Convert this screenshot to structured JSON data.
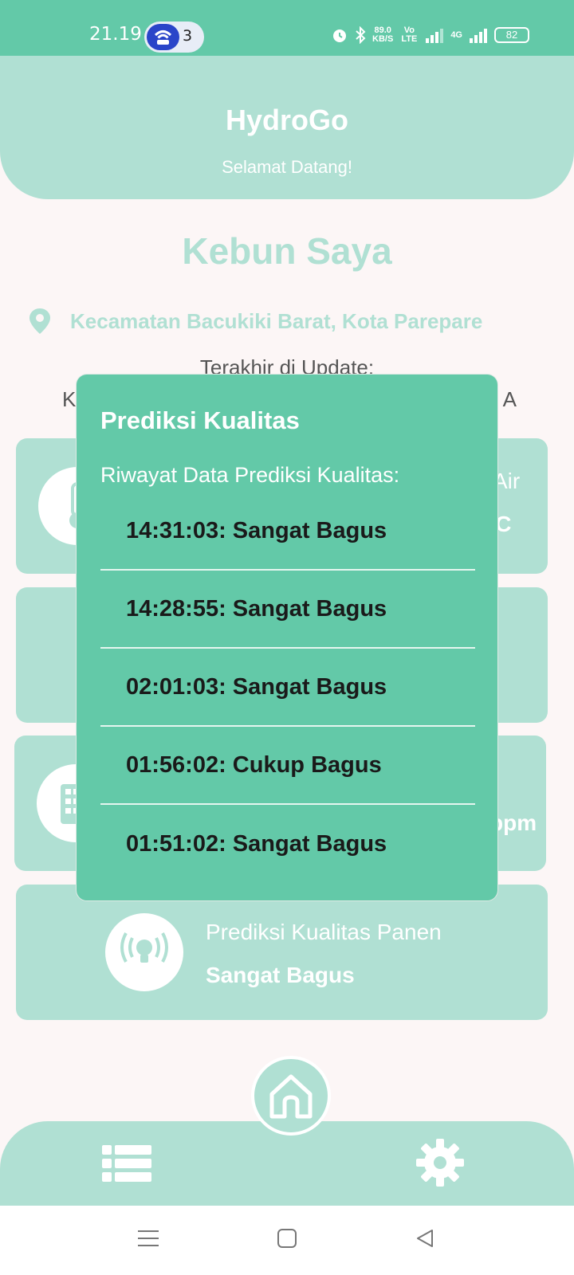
{
  "status_bar": {
    "time": "21.19",
    "notification_count": "3",
    "speed_value": "89.0",
    "speed_unit": "KB/S",
    "volte": "Vo LTE",
    "network": "4G",
    "battery": "82"
  },
  "header": {
    "title": "HydroGo",
    "subtitle": "Selamat Datang!"
  },
  "garden": {
    "title": "Kebun Saya",
    "location": "Kecamatan Bacukiki Barat, Kota Parepare",
    "updated_label": "Terakhir di Update:",
    "updated_left": "K",
    "updated_right": "A"
  },
  "cards": [
    {
      "label": "Air",
      "value": "°C",
      "icon": "thermometer-icon"
    },
    {
      "label": "",
      "value": "",
      "icon": ""
    },
    {
      "label": "",
      "value": "ppm",
      "icon": "building-icon"
    },
    {
      "label": "Prediksi Kualitas Panen",
      "value": "Sangat Bagus",
      "icon": "lightbulb-signal-icon"
    }
  ],
  "dialog": {
    "title": "Prediksi Kualitas",
    "subtitle": "Riwayat Data Prediksi Kualitas:",
    "items": [
      "14:31:03: Sangat Bagus",
      "14:28:55: Sangat Bagus",
      "02:01:03: Sangat Bagus",
      "01:56:02: Cukup Bagus",
      "01:51:02: Sangat Bagus"
    ]
  },
  "colors": {
    "primary": "#63c9a8",
    "light": "#b0e0d3",
    "background": "#fcf6f6"
  }
}
